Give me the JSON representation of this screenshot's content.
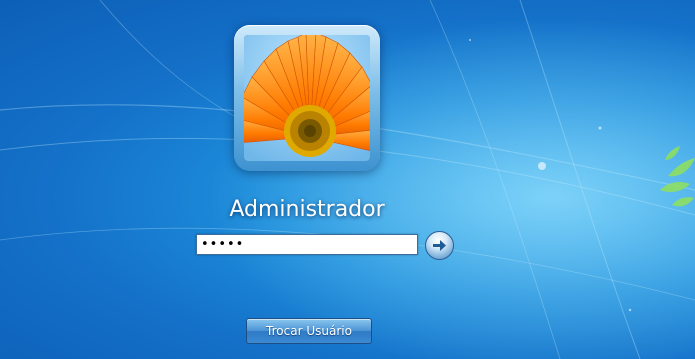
{
  "user": {
    "name": "Administrador",
    "picture_icon": "orange-gerbera-flower-icon"
  },
  "password": {
    "value": "•••••"
  },
  "submit": {
    "icon": "arrow-right-icon"
  },
  "switch_user": {
    "label": "Trocar Usuário"
  },
  "colors": {
    "background": "#1d8fdc",
    "button": "#3b8ad2"
  }
}
